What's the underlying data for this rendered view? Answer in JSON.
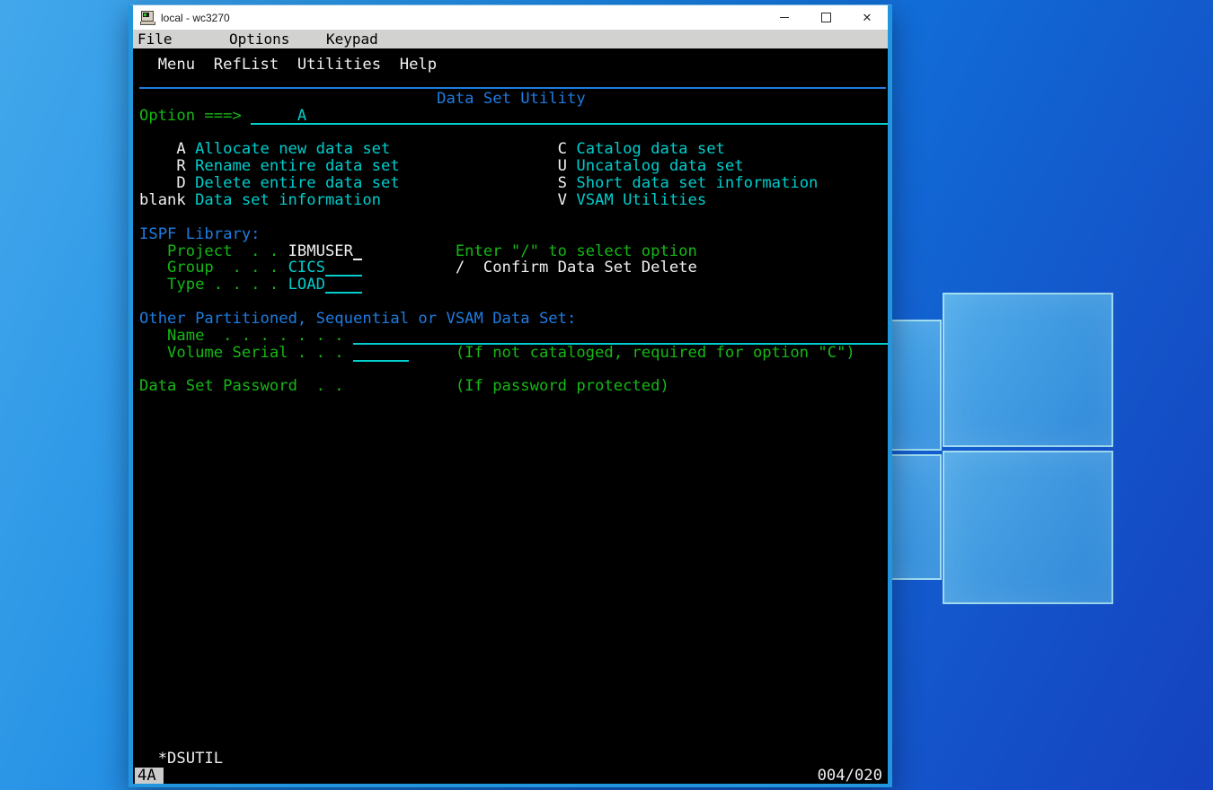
{
  "desktop": {
    "wallpaper": "windows-10-light-blue",
    "bg_top_color": "#0e8ce4",
    "bg_bottom_color": "#1848cd",
    "logo_pane_border_color": "#b2ecf8"
  },
  "window": {
    "title": "local - wc3270",
    "border_color": "#2196de",
    "icons": {
      "app": "terminal-3270",
      "minimize": "–",
      "maximize": "□",
      "close": "✕"
    },
    "menu": [
      "File",
      "Options",
      "Keypad"
    ]
  },
  "terminal": {
    "colors": {
      "background": "#000000",
      "green": "#15b815",
      "blue": "#1e7ce1",
      "turquoise": "#00cdcd",
      "white": "#f0f0f0"
    },
    "action_bar": [
      "Menu",
      "RefList",
      "Utilities",
      "Help"
    ],
    "title": "Data Set Utility",
    "option": {
      "label": "Option ===>",
      "value": "A"
    },
    "options_left": [
      {
        "key": "A",
        "desc": "Allocate new data set"
      },
      {
        "key": "R",
        "desc": "Rename entire data set"
      },
      {
        "key": "D",
        "desc": "Delete entire data set"
      },
      {
        "key": "blank",
        "desc": "Data set information"
      }
    ],
    "options_right": [
      {
        "key": "C",
        "desc": "Catalog data set"
      },
      {
        "key": "U",
        "desc": "Uncatalog data set"
      },
      {
        "key": "S",
        "desc": "Short data set information"
      },
      {
        "key": "V",
        "desc": "VSAM Utilities"
      }
    ],
    "library": {
      "heading": "ISPF Library:",
      "project_label": "Project  . .",
      "project_value": "IBMUSER",
      "group_label": "Group  . . .",
      "group_value": "CICS",
      "type_label": "Type . . . .",
      "type_value": "LOAD"
    },
    "select_option": {
      "hint": "Enter \"/\" to select option",
      "slash": "/",
      "confirm_label": "Confirm Data Set Delete"
    },
    "other_data_set": {
      "heading": "Other Partitioned, Sequential or VSAM Data Set:",
      "name_label": "Name  . . . . . . .",
      "name_value": "",
      "volume_label": "Volume Serial . . .",
      "volume_value": "",
      "volume_hint": "(If not cataloged, required for option \"C\")"
    },
    "password": {
      "label": "Data Set Password  . .",
      "hint": "(If password protected)"
    },
    "status_message": "*DSUTIL",
    "oia": {
      "status": "4A",
      "cursor_position": "004/020"
    }
  }
}
